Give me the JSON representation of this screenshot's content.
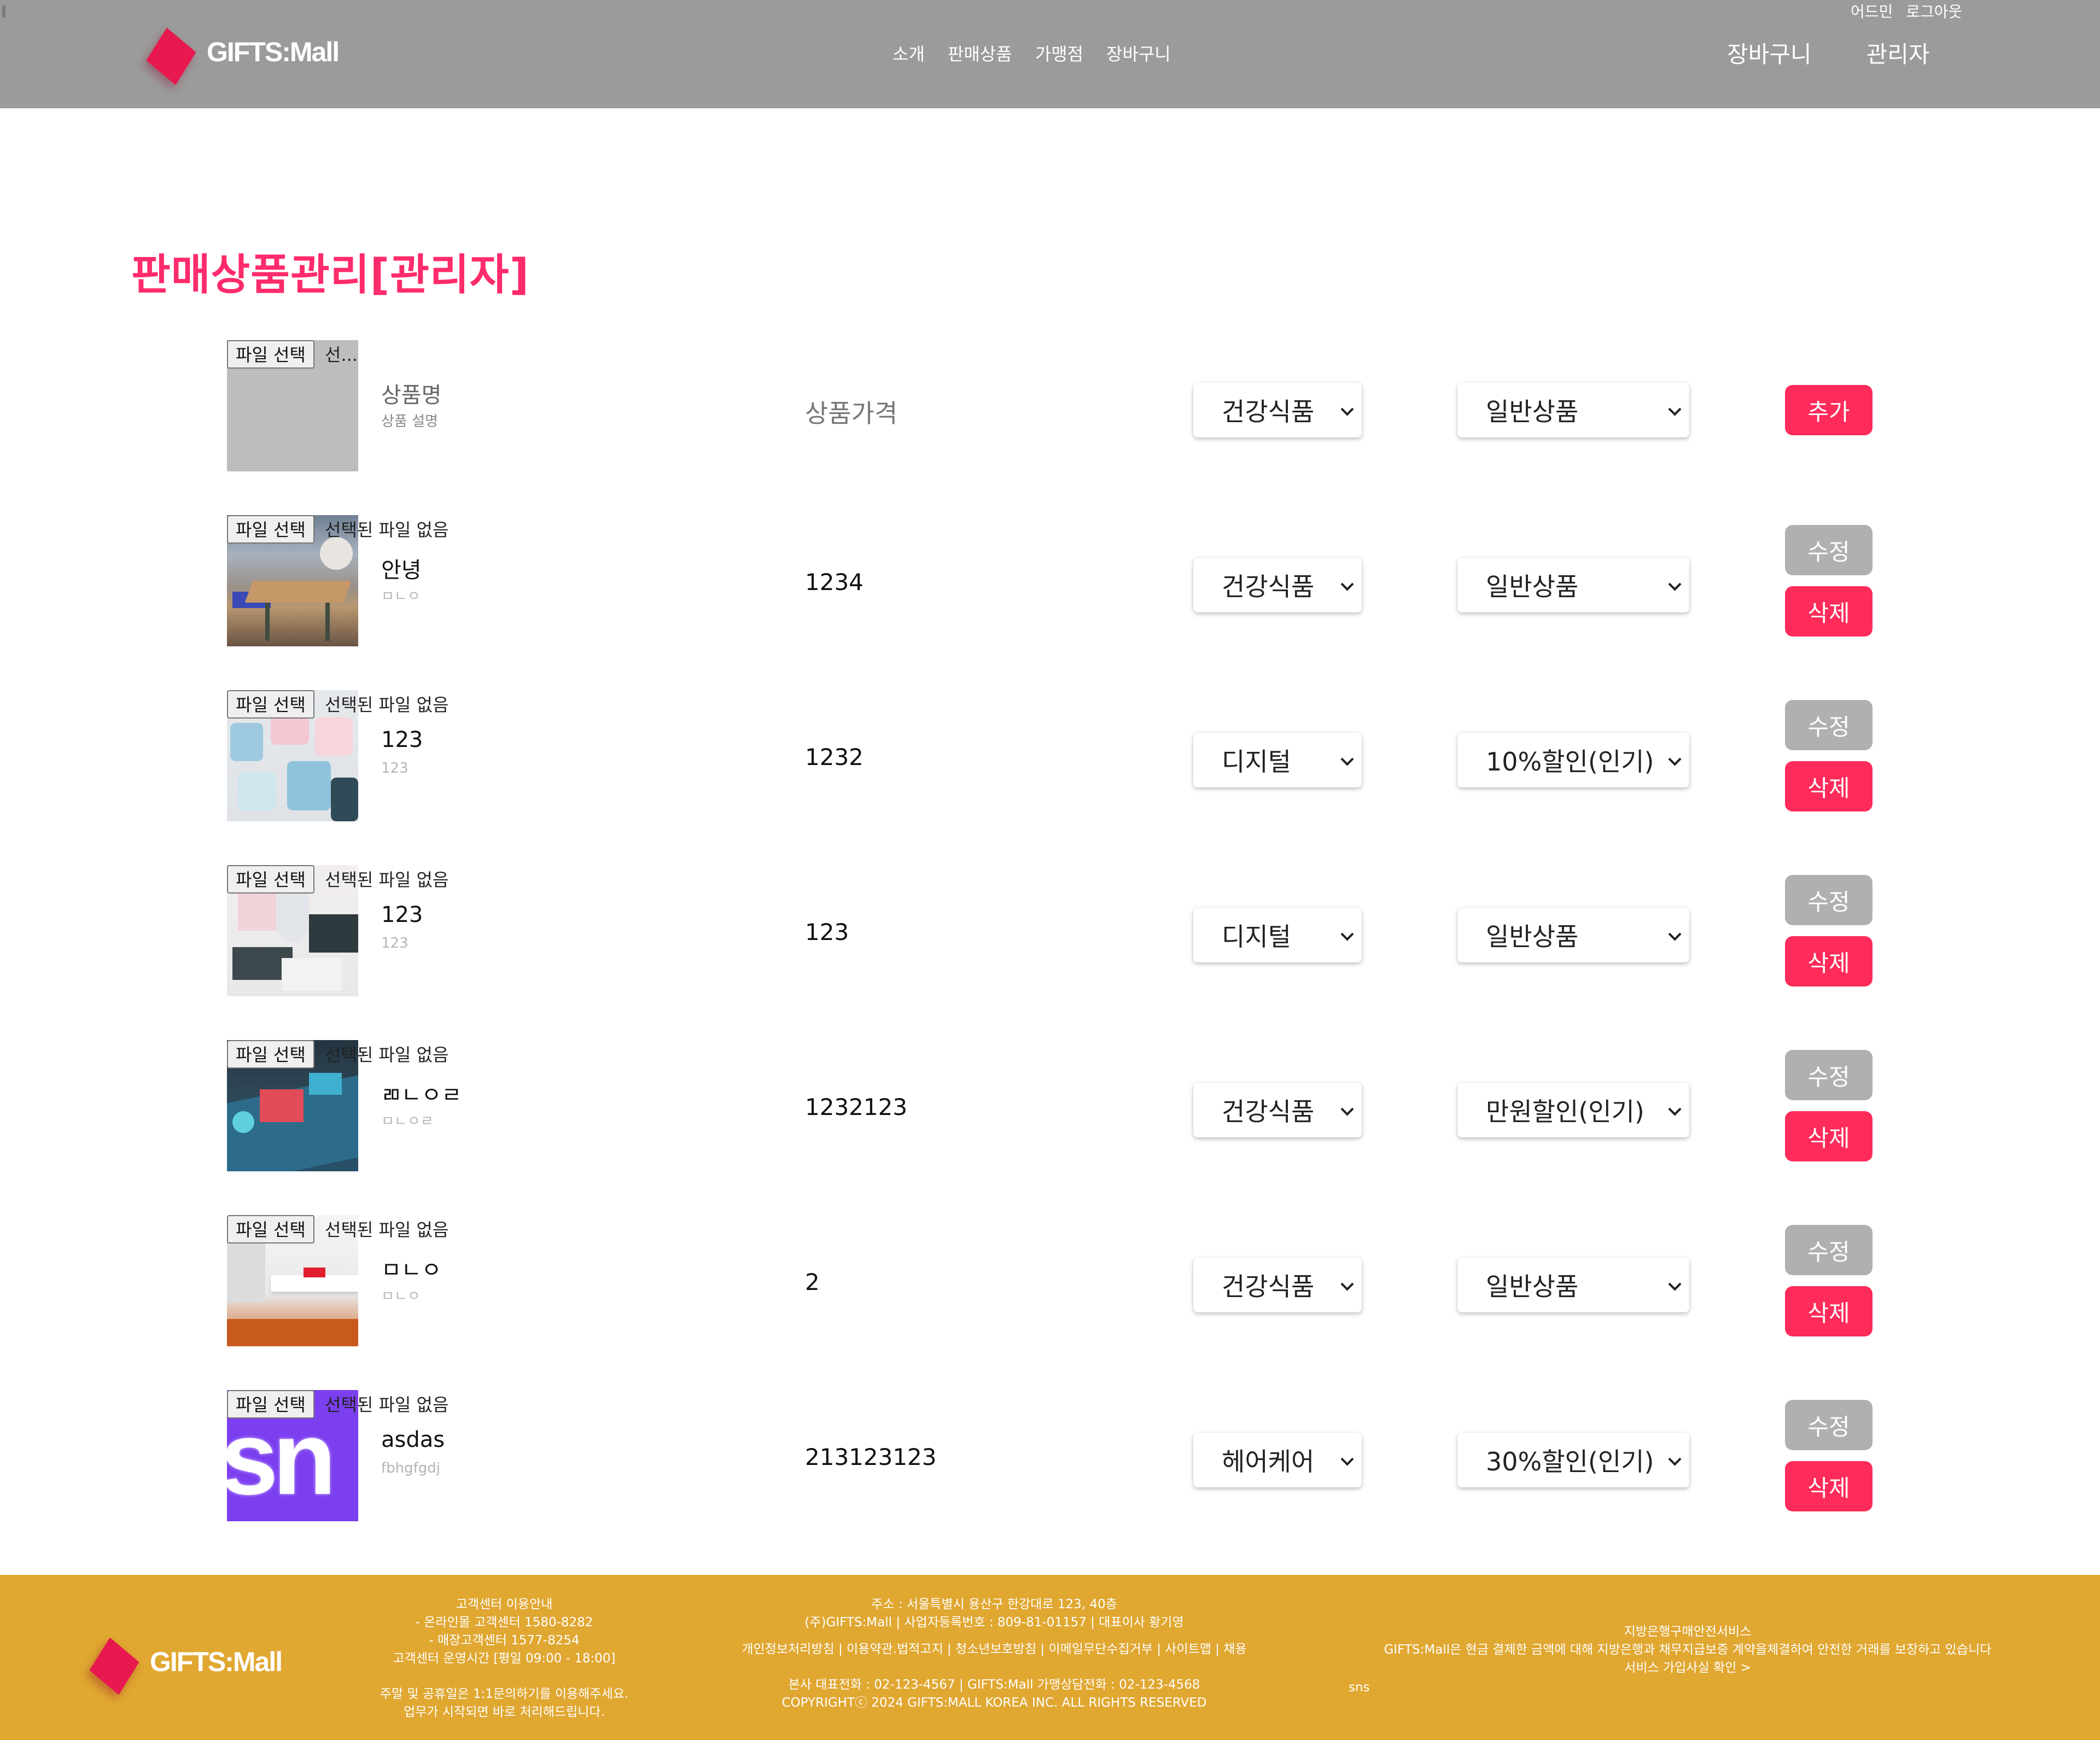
{
  "header": {
    "logo_text": "GIFTS:Mall",
    "util_links": [
      "어드민",
      "로그아웃"
    ],
    "nav": [
      "소개",
      "판매상품",
      "가맹점",
      "장바구니"
    ],
    "right_links": [
      "장바구니",
      "관리자"
    ]
  },
  "page_title": "판매상품관리[관리자]",
  "add_row": {
    "file_button": "파일 선택",
    "file_status": "선...",
    "name_placeholder": "상품명",
    "desc_placeholder": "상품 설명",
    "price_placeholder": "상품가격",
    "category": "건강식품",
    "tag": "일반상품",
    "add_label": "추가"
  },
  "products": [
    {
      "file_button": "파일 선택",
      "file_status": "선택된 파일 없음",
      "photo": "office-lounge",
      "name": "안녕",
      "desc": "ㅁㄴㅇ",
      "price": "1234",
      "category": "건강식품",
      "tag": "일반상품",
      "edit_label": "수정",
      "delete_label": "삭제"
    },
    {
      "file_button": "파일 선택",
      "file_status": "선택된 파일 없음",
      "photo": "gift-boxes",
      "name": "123",
      "desc": "123",
      "price": "1232",
      "category": "디지털",
      "tag": "10%할인(인기)",
      "edit_label": "수정",
      "delete_label": "삭제"
    },
    {
      "file_button": "파일 선택",
      "file_status": "선택된 파일 없음",
      "photo": "product-boxes",
      "name": "123",
      "desc": "123",
      "price": "123",
      "category": "디지털",
      "tag": "일반상품",
      "edit_label": "수정",
      "delete_label": "삭제"
    },
    {
      "file_button": "파일 선택",
      "file_status": "선택된 파일 없음",
      "photo": "desk-display",
      "name": "ㄻㄴㅇㄹ",
      "desc": "ㅁㄴㅇㄹ",
      "price": "1232123",
      "category": "건강식품",
      "tag": "만원할인(인기)",
      "edit_label": "수정",
      "delete_label": "삭제"
    },
    {
      "file_button": "파일 선택",
      "file_status": "선택된 파일 없음",
      "photo": "shelf-display",
      "name": "ㅁㄴㅇ",
      "desc": "ㅁㄴㅇ",
      "price": "2",
      "category": "건강식품",
      "tag": "일반상품",
      "edit_label": "수정",
      "delete_label": "삭제"
    },
    {
      "file_button": "파일 선택",
      "file_status": "선택된 파일 없음",
      "photo": "purple-sn",
      "photo_text": "sn",
      "name": "asdas",
      "desc": "fbhgfgdj",
      "price": "213123123",
      "category": "헤어케어",
      "tag": "30%할인(인기)",
      "edit_label": "수정",
      "delete_label": "삭제"
    }
  ],
  "footer": {
    "logo_text": "GIFTS:Mall",
    "cs_lines": [
      "고객센터 이용안내",
      "- 온라인몰 고객센터 1580-8282",
      "- 매장고객센터 1577-8254",
      "고객센터 운영시간 [평일 09:00 - 18:00]",
      "주말 및 공휴일은 1:1문의하기를 이용해주세요.",
      "업무가 시작되면 바로 처리해드립니다."
    ],
    "addr_lines": [
      "주소 : 서울특별시 용산구 한강대로 123, 40층",
      "(주)GIFTS:Mall | 사업자등록번호 : 809-81-01157 | 대표이사 황기영",
      "개인정보처리방침 | 이용약관.법적고지 | 청소년보호방침 | 이메일무단수집거부 | 사이트맵 | 채용",
      "본사 대표전화 : 02-123-4567 | GIFTS:Mall 가맹상담전화 : 02-123-4568",
      "COPYRIGHTⓒ 2024 GIFTS:MALL KOREA INC. ALL RIGHTS RESERVED"
    ],
    "side_lines": [
      "지방은행구매안전서비스",
      "GIFTS:Mall은 현금 결제한 금액에 대해 지방은행과 채무지급보증 계약을체결하여 안전한 거래를 보장하고 있습니다",
      "서비스 가입사실 확인 >"
    ],
    "sns": "sns"
  },
  "colors": {
    "accent": "#ff2b6a",
    "header_bg": "#9b9b9b",
    "footer_bg": "#e0a731",
    "edit_btn": "#b0b0b0",
    "delete_btn": "#ff2b5a"
  }
}
